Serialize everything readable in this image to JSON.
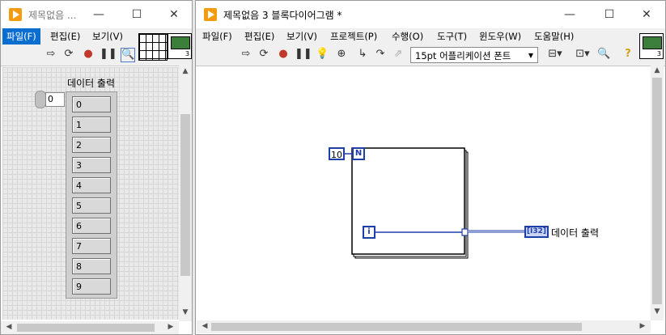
{
  "front_panel": {
    "title": "제목없음 ...",
    "menu": [
      "파일(F)",
      "편집(E)",
      "보기(V)"
    ],
    "index_value": "0",
    "array_label": "데이터 출력",
    "array_values": [
      "0",
      "1",
      "2",
      "3",
      "4",
      "5",
      "6",
      "7",
      "8",
      "9"
    ],
    "icon_number": "3"
  },
  "block_diagram": {
    "title": "제목없음 3 블록다이어그램 *",
    "menu": [
      "파일(F)",
      "편집(E)",
      "보기(V)",
      "프로젝트(P)",
      "수행(O)",
      "도구(T)",
      "윈도우(W)",
      "도움말(H)"
    ],
    "font_label": "15pt 어플리케이션 폰트",
    "loop_count_const": "10",
    "count_terminal": "N",
    "iteration_terminal": "i",
    "indicator_type": "[I32]",
    "indicator_label": "데이터 출력",
    "icon_number": "3"
  },
  "window_controls": {
    "minimize": "—",
    "maximize": "☐",
    "close": "✕"
  },
  "colors": {
    "wire": "#1f3ea8",
    "menu_active": "#0a6ed1",
    "app_icon": "#f39c12"
  }
}
